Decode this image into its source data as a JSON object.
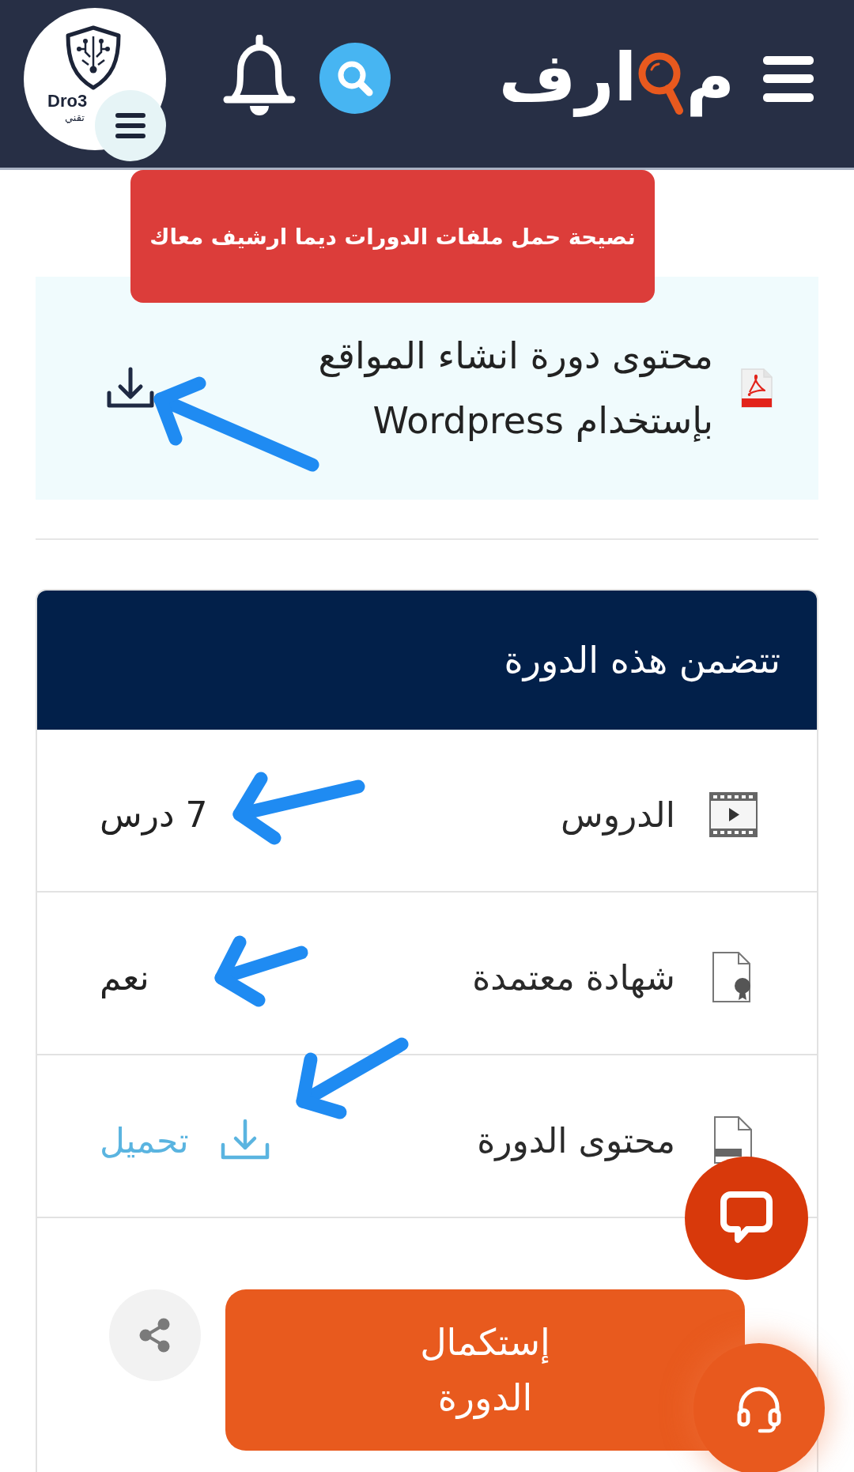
{
  "header": {
    "avatar": {
      "texts": [
        "Dro3",
        "تقني"
      ]
    },
    "logo": {
      "parts": [
        "م",
        "ارف"
      ]
    }
  },
  "notice": {
    "text": "نصيحة حمل ملفات الدورات ديما ارشيف معاك"
  },
  "file": {
    "title": "محتوى دورة انشاء المواقع بإستخدام Wordpress"
  },
  "includes": {
    "title": "تتضمن هذه الدورة",
    "rows": [
      {
        "kind": "text",
        "label": "الدروس",
        "value": "7 درس"
      },
      {
        "kind": "text",
        "label": "شهادة معتمدة",
        "value": "نعم"
      },
      {
        "kind": "download",
        "label": "محتوى الدورة",
        "value": "تحميل"
      }
    ]
  },
  "actions": {
    "primary": "إستكمال الدورة"
  }
}
